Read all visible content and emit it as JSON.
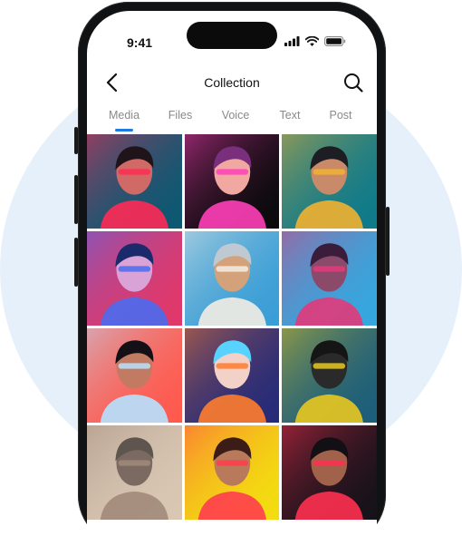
{
  "status_bar": {
    "time": "9:41"
  },
  "nav": {
    "title": "Collection"
  },
  "tabs": [
    {
      "label": "Media",
      "active": true
    },
    {
      "label": "Files",
      "active": false
    },
    {
      "label": "Voice",
      "active": false
    },
    {
      "label": "Text",
      "active": false
    },
    {
      "label": "Post",
      "active": false
    }
  ],
  "media_grid": [
    {
      "bg": "#0d5872",
      "accent": "#ff2a55",
      "skin": "#cf6a66",
      "hair": "#20141b"
    },
    {
      "bg": "#0a0a0c",
      "accent": "#ff3fb8",
      "skin": "#f0a8a0",
      "hair": "#7a2f7c"
    },
    {
      "bg": "#0f7a8a",
      "accent": "#f2b130",
      "skin": "#c98a6a",
      "hair": "#1d1d24"
    },
    {
      "bg": "#e0386a",
      "accent": "#4a6cf0",
      "skin": "#d9a3d8",
      "hair": "#1b2a6b"
    },
    {
      "bg": "#3a9ed6",
      "accent": "#f3ede4",
      "skin": "#d3a17a",
      "hair": "#bfc9d2"
    },
    {
      "bg": "#35a7de",
      "accent": "#e23a7a",
      "skin": "#8b4a6a",
      "hair": "#3a1d3a"
    },
    {
      "bg": "#ff5a4e",
      "accent": "#b6e2ff",
      "skin": "#c27a62",
      "hair": "#141016"
    },
    {
      "bg": "#262b78",
      "accent": "#ff7d2e",
      "skin": "#f2d2c8",
      "hair": "#58d2ff"
    },
    {
      "bg": "#1d5e7a",
      "accent": "#e8c820",
      "skin": "#2a2a2a",
      "hair": "#151515"
    },
    {
      "bg": "#d9c6b3",
      "accent": "#a18a7a",
      "skin": "#7a6a62",
      "hair": "#5f554f"
    },
    {
      "bg": "#f3dc10",
      "accent": "#ff3d4e",
      "skin": "#b87a5a",
      "hair": "#3b1c16"
    },
    {
      "bg": "#17121a",
      "accent": "#ff3050",
      "skin": "#a0624a",
      "hair": "#121014"
    }
  ]
}
